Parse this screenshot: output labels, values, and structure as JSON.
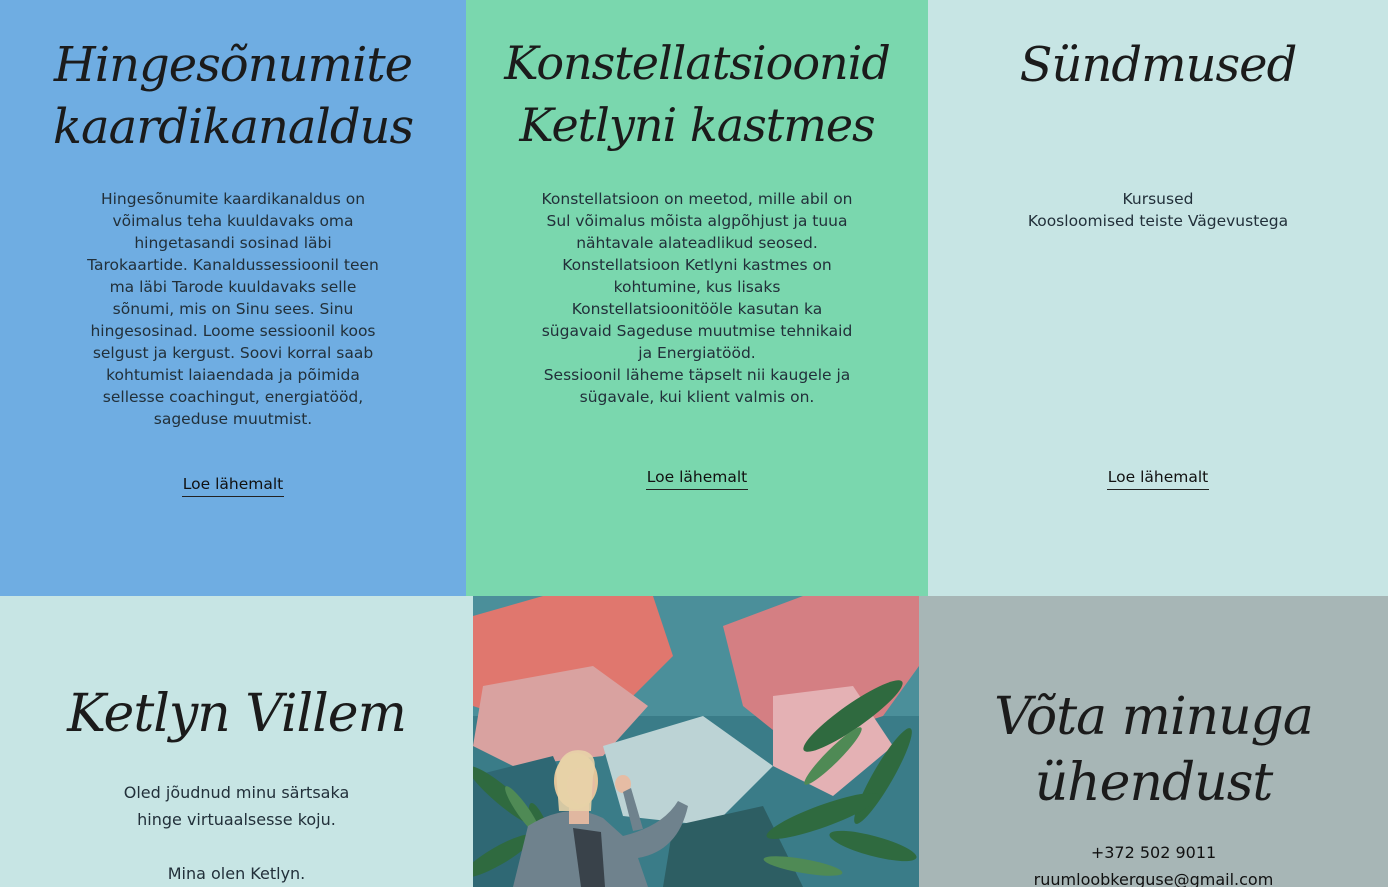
{
  "panels": {
    "tarot": {
      "title_line1": "Hingesõnumite",
      "title_line2": "kaardikanaldus",
      "text_lines": [
        "Hingesõnumite kaardikanaldus on",
        "võimalus teha kuuldavaks oma",
        "hingetasandi sosinad läbi",
        "Tarokaartide. Kanaldussessioonil teen",
        "ma läbi Tarode kuuldavaks selle",
        "sõnumi, mis on Sinu sees. Sinu",
        "hingesosinad. Loome sessioonil koos",
        "selgust ja kergust. Soovi korral saab",
        "kohtumist laiaendada ja põimida",
        "sellesse coachingut, energiatööd,",
        "sageduse muutmist."
      ],
      "cta_label": "Loe lähemalt",
      "bg": "#6fade2"
    },
    "constellations": {
      "title_line1": "Konstellatsioonid",
      "title_line2": "Ketlyni kastmes",
      "text_lines": [
        "Konstellatsioon on meetod, mille abil on",
        "Sul võimalus mõista algpõhjust ja tuua",
        "nähtavale alateadlikud seosed.",
        "Konstellatsioon Ketlyni kastmes on",
        "kohtumine, kus lisaks",
        "Konstellatsioonitööle kasutan ka",
        "sügavaid Sageduse muutmise tehnikaid",
        "ja Energiatööd.",
        "Sessioonil läheme täpselt nii kaugele ja",
        "sügavale, kui klient valmis on."
      ],
      "cta_label": "Loe lähemalt",
      "bg": "#7ad7ae"
    },
    "events": {
      "title": "Sündmused",
      "text_lines": [
        "Kursused",
        "Koosloomised teiste Vägevustega"
      ],
      "cta_label": "Loe lähemalt",
      "bg": "#c7e5e4"
    },
    "about": {
      "title": "Ketlyn Villem",
      "text_line1": "Oled jõudnud minu särtsaka",
      "text_line2": "hinge virtuaalsesse koju.",
      "text_line3": "Mina olen Ketlyn.",
      "bg": "#c7e5e4"
    },
    "contact": {
      "title_line1": "Võta minuga",
      "title_line2": "ühendust",
      "phone": "+372 502 9011",
      "email": "ruumloobkerguse@gmail.com",
      "bg": "#a7b6b6"
    }
  }
}
